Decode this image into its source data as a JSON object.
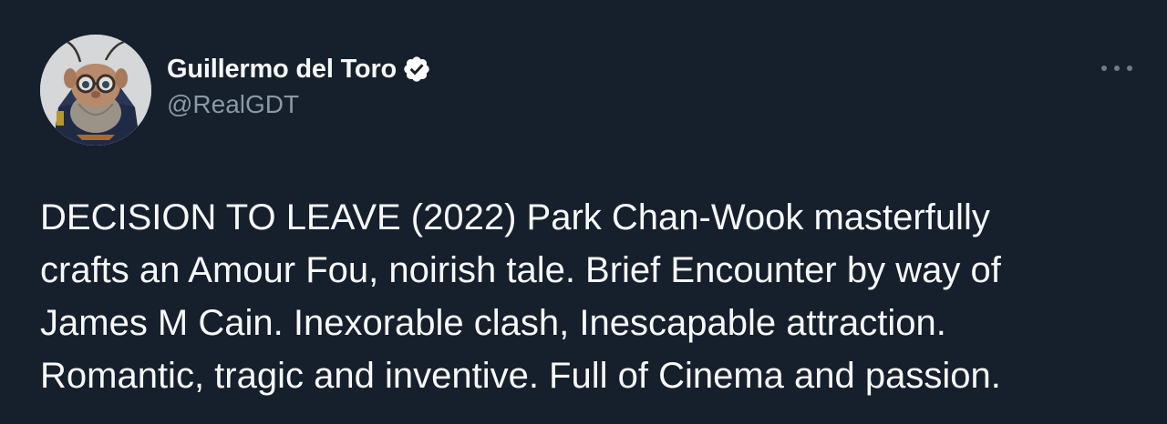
{
  "author": {
    "display_name": "Guillermo del Toro",
    "handle": "@RealGDT",
    "verified_icon": "verified-badge-icon",
    "avatar_icon": "puppet-character-avatar"
  },
  "tweet": {
    "lines": [
      "DECISION TO LEAVE (2022) Park Chan-Wook masterfully",
      "crafts an Amour Fou, noirish tale. Brief Encounter by way of",
      "James M Cain. Inexorable clash, Inescapable attraction.",
      "Romantic, tragic and inventive. Full of Cinema and passion."
    ]
  },
  "menu": {
    "icon": "more-options-icon"
  },
  "colors": {
    "background": "#161f2c",
    "text": "#f7f9f9",
    "secondary_text": "#8b98a5",
    "icon_muted": "#6e7b88"
  }
}
